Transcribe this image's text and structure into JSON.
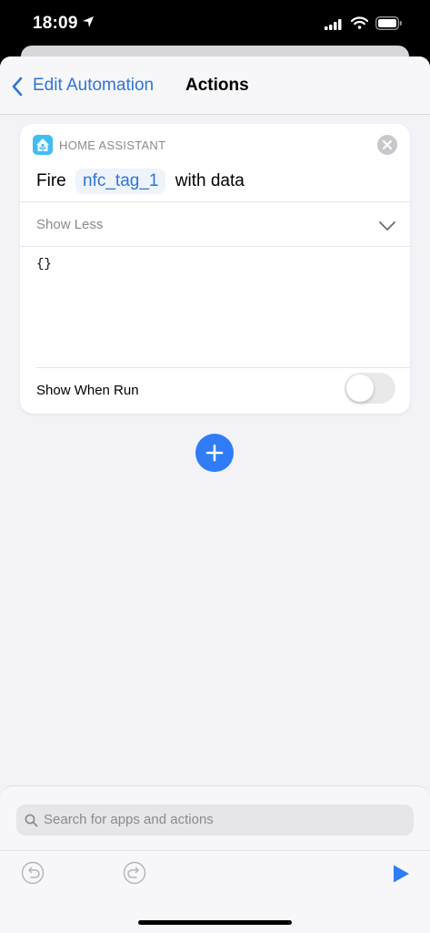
{
  "status_bar": {
    "time": "18:09"
  },
  "nav": {
    "back_label": "Edit Automation",
    "title": "Actions"
  },
  "card": {
    "app_name": "HOME ASSISTANT",
    "action_prefix": "Fire",
    "event_token": "nfc_tag_1",
    "action_suffix": "with data",
    "show_less_label": "Show Less",
    "data_value": "{}",
    "show_when_run_label": "Show When Run",
    "show_when_run_enabled": false
  },
  "search": {
    "placeholder": "Search for apps and actions"
  },
  "colors": {
    "accent": "#2f74d8",
    "add_button": "#2f7cf6",
    "home_assistant": "#41bdf5"
  },
  "icons": {
    "location": "location-arrow-icon",
    "signal": "cellular-signal-icon",
    "wifi": "wifi-icon",
    "battery": "battery-icon",
    "back": "chevron-left-icon",
    "app": "home-assistant-icon",
    "close": "close-icon",
    "expand": "chevron-down-icon",
    "add": "plus-icon",
    "search": "search-icon",
    "undo": "undo-icon",
    "redo": "redo-icon",
    "run": "play-icon"
  }
}
